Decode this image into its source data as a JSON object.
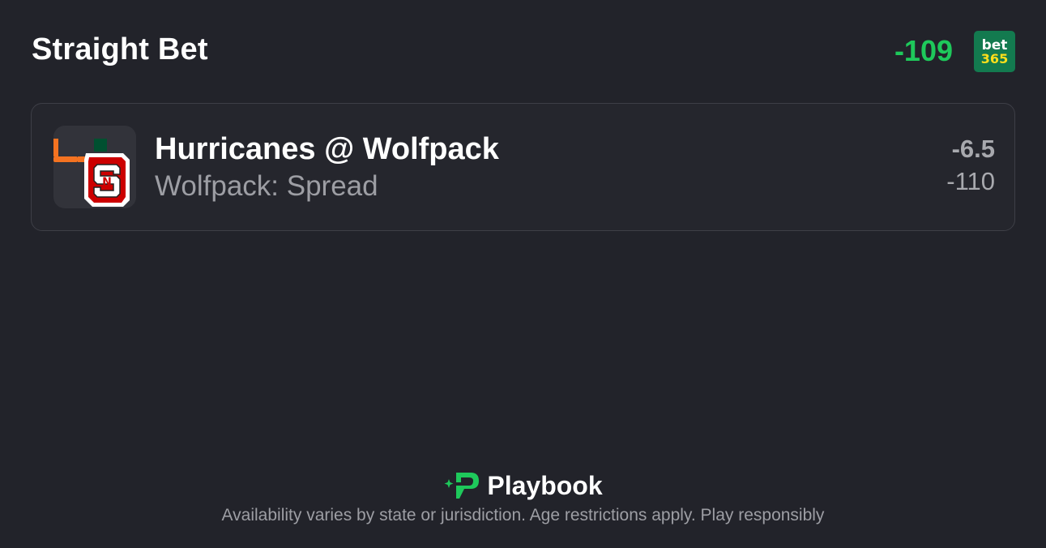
{
  "header": {
    "title": "Straight Bet",
    "odds": "-109",
    "sportsbook": {
      "name_line1": "bet",
      "name_line2": "365",
      "bg_color": "#137a4f",
      "text_color": "#ffffff",
      "accent_color": "#ffdf1b"
    },
    "odds_color": "#1ec95b"
  },
  "bet": {
    "matchup": "Hurricanes @ Wolfpack",
    "market": "Wolfpack: Spread",
    "line": "-6.5",
    "price": "-110",
    "team_logo_icons": [
      "miami-u-logo-icon",
      "nc-state-s-logo-icon"
    ]
  },
  "footer": {
    "brand": "Playbook",
    "brand_icon": "playbook-logo-icon",
    "brand_color": "#1ec95b",
    "disclaimer": "Availability varies by state or jurisdiction. Age restrictions apply. Play responsibly"
  }
}
